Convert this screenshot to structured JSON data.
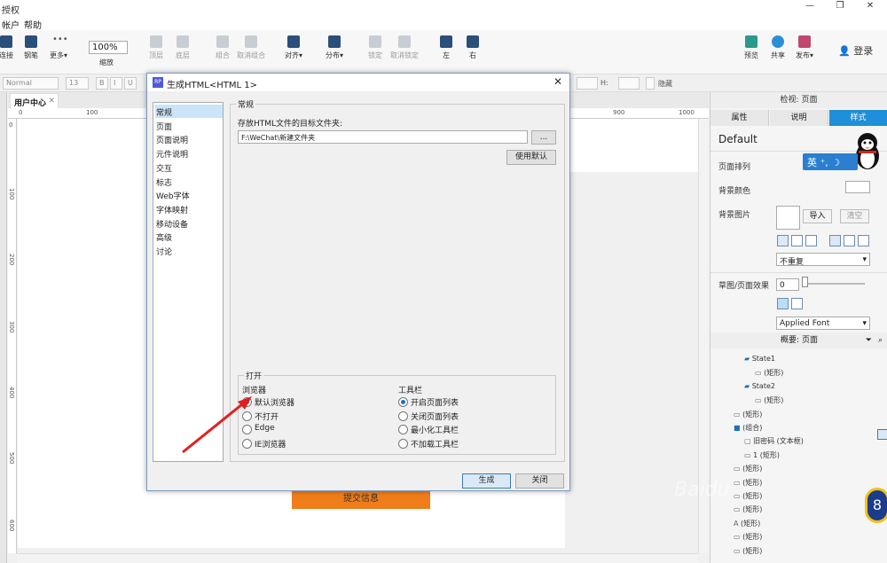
{
  "window": {
    "title": "授权",
    "minimize": "—",
    "restore": "❐",
    "close": "✕"
  },
  "menu": [
    "帐户",
    "帮助"
  ],
  "toolbar": {
    "items": [
      {
        "label": "连接",
        "icon": "connect-icon"
      },
      {
        "label": "钢笔",
        "icon": "pen-icon"
      },
      {
        "label": "更多▾",
        "icon": "more-icon"
      },
      {
        "label": "缩放",
        "icon": "zoom-icon"
      },
      {
        "label": "顶层",
        "icon": "bring-front-icon"
      },
      {
        "label": "底层",
        "icon": "send-back-icon"
      },
      {
        "label": "组合",
        "icon": "group-icon"
      },
      {
        "label": "取消组合",
        "icon": "ungroup-icon"
      },
      {
        "label": "对齐▾",
        "icon": "align-icon"
      },
      {
        "label": "分布▾",
        "icon": "distribute-icon"
      },
      {
        "label": "锁定",
        "icon": "lock-icon"
      },
      {
        "label": "取消锁定",
        "icon": "unlock-icon"
      },
      {
        "label": "左",
        "icon": "left-icon"
      },
      {
        "label": "右",
        "icon": "right-icon"
      },
      {
        "label": "预览",
        "icon": "preview-icon"
      },
      {
        "label": "共享",
        "icon": "share-icon"
      },
      {
        "label": "发布▾",
        "icon": "publish-icon"
      }
    ],
    "zoom_value": "100%",
    "login": "登录"
  },
  "format": {
    "style": "Normal",
    "size": "13",
    "bold": "B",
    "italic": "I",
    "underline": "U",
    "h_label": "H:",
    "hidden": "隐藏"
  },
  "doc_tab": {
    "label": "用户中心",
    "close": "✕"
  },
  "ruler_top": [
    "0",
    "100",
    "900",
    "1000"
  ],
  "ruler_left": [
    "0",
    "100",
    "200",
    "300",
    "400",
    "500",
    "600"
  ],
  "canvas": {
    "submit_button": "提交信息"
  },
  "right_panel": {
    "inspector_title": "检视: 页面",
    "tabs": [
      "属性",
      "说明",
      "样式"
    ],
    "style_name": "Default",
    "page_align_label": "页面排列",
    "bg_color_label": "背景颜色",
    "bg_image_label": "背景图片",
    "import_btn": "导入",
    "clear_btn": "清空",
    "repeat_value": "不重复",
    "sketch_label": "草图/页面效果",
    "sketch_value": "0",
    "font_value": "Applied Font",
    "outline_title": "概要: 页面",
    "outline": [
      {
        "indent": 2,
        "text": "State1",
        "icon": "state-icon"
      },
      {
        "indent": 3,
        "text": "(矩形)",
        "icon": "rect-icon"
      },
      {
        "indent": 2,
        "text": "State2",
        "icon": "state-icon"
      },
      {
        "indent": 3,
        "text": "(矩形)",
        "icon": "rect-icon"
      },
      {
        "indent": 1,
        "text": "(矩形)",
        "icon": "rect-icon"
      },
      {
        "indent": 1,
        "text": "(组合)",
        "icon": "folder-icon"
      },
      {
        "indent": 2,
        "text": "旧密码 (文本框)",
        "icon": "textbox-icon"
      },
      {
        "indent": 2,
        "text": "1 (矩形)",
        "icon": "rect-icon"
      },
      {
        "indent": 1,
        "text": "(矩形)",
        "icon": "rect-icon"
      },
      {
        "indent": 1,
        "text": "(矩形)",
        "icon": "rect-icon"
      },
      {
        "indent": 1,
        "text": "(矩形)",
        "icon": "rect-icon"
      },
      {
        "indent": 1,
        "text": "(矩形)",
        "icon": "rect-icon"
      },
      {
        "indent": 1,
        "text": "(矩形)",
        "icon": "text-icon"
      },
      {
        "indent": 1,
        "text": "(矩形)",
        "icon": "rect-icon"
      },
      {
        "indent": 1,
        "text": "(矩形)",
        "icon": "rect-icon"
      }
    ]
  },
  "ime": {
    "label": "英 ⁺, ☽"
  },
  "dialog": {
    "title": "生成HTML<HTML 1>",
    "nav": [
      "常规",
      "页面",
      "页面说明",
      "元件说明",
      "交互",
      "标志",
      "Web字体",
      "字体映射",
      "移动设备",
      "高级",
      "讨论"
    ],
    "selected_nav": 0,
    "section_title": "常规",
    "folder_label": "存放HTML文件的目标文件夹:",
    "folder_value": "F:\\WeChat\\新建文件夹",
    "browse_btn": "...",
    "default_btn": "使用默认",
    "open_group": "打开",
    "browser_label": "浏览器",
    "browser_options": [
      {
        "label": "默认浏览器",
        "checked": true
      },
      {
        "label": "不打开",
        "checked": false
      },
      {
        "label": "Edge",
        "checked": false
      },
      {
        "label": "IE浏览器",
        "checked": false
      }
    ],
    "toolbar_label": "工具栏",
    "toolbar_options": [
      {
        "label": "开启页面列表",
        "checked": true
      },
      {
        "label": "关闭页面列表",
        "checked": false
      },
      {
        "label": "最小化工具栏",
        "checked": false
      },
      {
        "label": "不加载工具栏",
        "checked": false
      }
    ],
    "generate_btn": "生成",
    "close_btn": "关闭"
  },
  "colors": {
    "accent": "#1e8fd8",
    "submit": "#f07d1a",
    "arrow": "#e02020"
  },
  "overlay": {
    "badge": "8",
    "watermark": "Baidu"
  }
}
